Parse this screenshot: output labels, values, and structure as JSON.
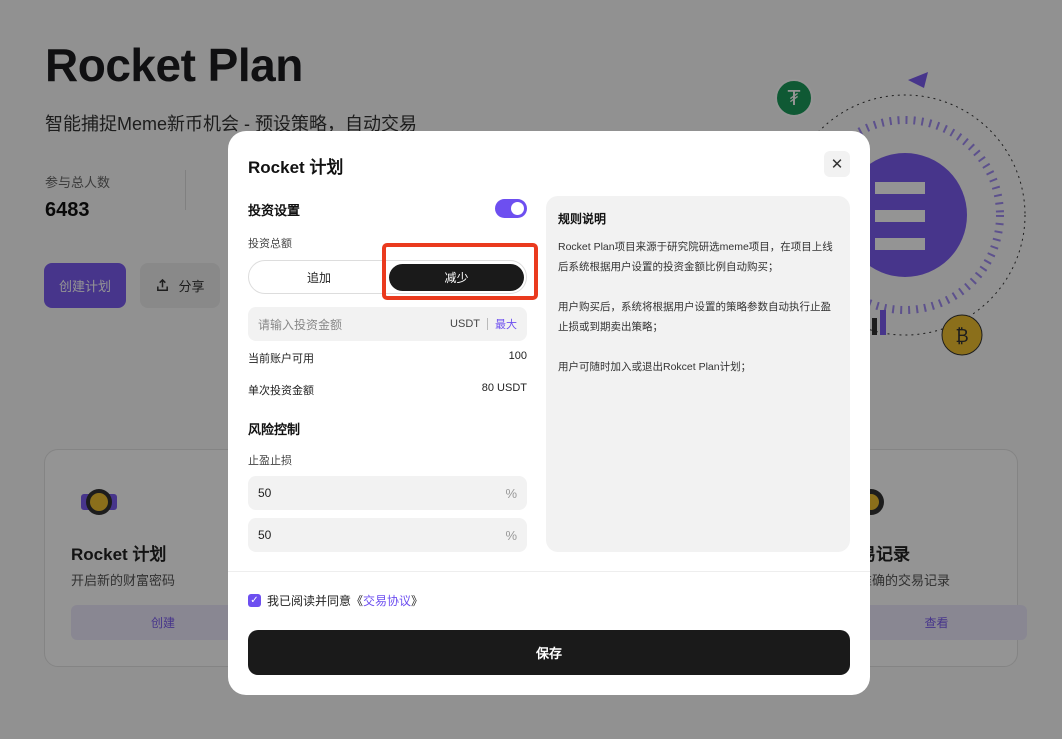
{
  "background": {
    "title": "Rocket Plan",
    "subtitle": "智能捕捉Meme新币机会 - 预设策略，自动交易",
    "participants_label": "参与总人数",
    "participants_value": "6483",
    "create_plan_label": "创建计划",
    "share_label": "分享",
    "card_left": {
      "title": "Rocket 计划",
      "desc": "开启新的财富密码",
      "button": "创建"
    },
    "card_right": {
      "title": "易记录",
      "desc": "准确的交易记录",
      "button": "查看"
    }
  },
  "modal": {
    "title": "Rocket 计划",
    "investment_section": "投资设置",
    "investment_enabled": true,
    "total_amount_label": "投资总额",
    "mode_add": "追加",
    "mode_reduce": "减少",
    "mode_selected": "减少",
    "amount_placeholder": "请输入投资金额",
    "amount_unit": "USDT",
    "amount_max": "最大",
    "available_label": "当前账户可用",
    "available_value": "100",
    "single_label": "单次投资金额",
    "single_value": "80 USDT",
    "risk_section": "风险控制",
    "tp_sl_label": "止盈止损",
    "take_profit_value": "50",
    "stop_loss_value": "50",
    "percent_symbol": "%",
    "rules_title": "规则说明",
    "rules": [
      "Rocket Plan项目来源于研究院研选meme项目，在项目上线后系统根据用户设置的投资金额比例自动购买；",
      "用户购买后，系统将根据用户设置的策略参数自动执行止盈止损或到期卖出策略；",
      "用户可随时加入或退出Rokcet Plan计划；"
    ],
    "agree_prefix": "我已阅读并同意《",
    "agree_link": "交易协议",
    "agree_suffix": "》",
    "agree_checked": true,
    "save_label": "保存"
  },
  "colors": {
    "accent": "#6d4ff0",
    "highlight": "#ea3a1e",
    "dark_button": "#1a1a1a"
  }
}
